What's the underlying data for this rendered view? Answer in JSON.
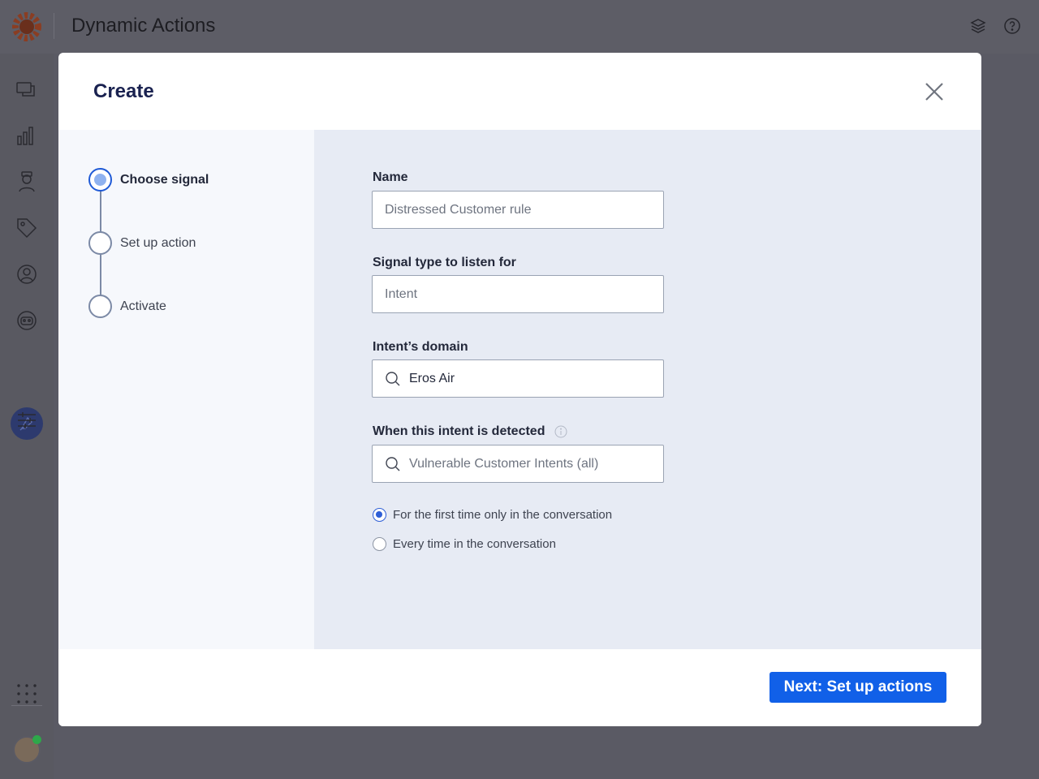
{
  "app": {
    "title": "Dynamic Actions"
  },
  "modal": {
    "title": "Create",
    "steps": [
      {
        "label": "Choose signal",
        "active": true
      },
      {
        "label": "Set up action",
        "active": false
      },
      {
        "label": "Activate",
        "active": false
      }
    ],
    "form": {
      "name": {
        "label": "Name",
        "placeholder": "Distressed Customer rule"
      },
      "signal_type": {
        "label": "Signal type to listen for",
        "placeholder": "Intent"
      },
      "intent_domain": {
        "label": "Intent’s domain",
        "value": "Eros Air"
      },
      "intent_detected": {
        "label": "When this intent is detected",
        "placeholder": "Vulnerable Customer Intents (all)"
      },
      "frequency": {
        "options": [
          {
            "label": "For the first time only in the conversation",
            "checked": true
          },
          {
            "label": "Every time in the conversation",
            "checked": false
          }
        ]
      }
    },
    "footer": {
      "next_label": "Next: Set up actions"
    }
  },
  "colors": {
    "primary": "#1160e8",
    "title": "#1a2250",
    "overlay": "#5a5a64"
  }
}
